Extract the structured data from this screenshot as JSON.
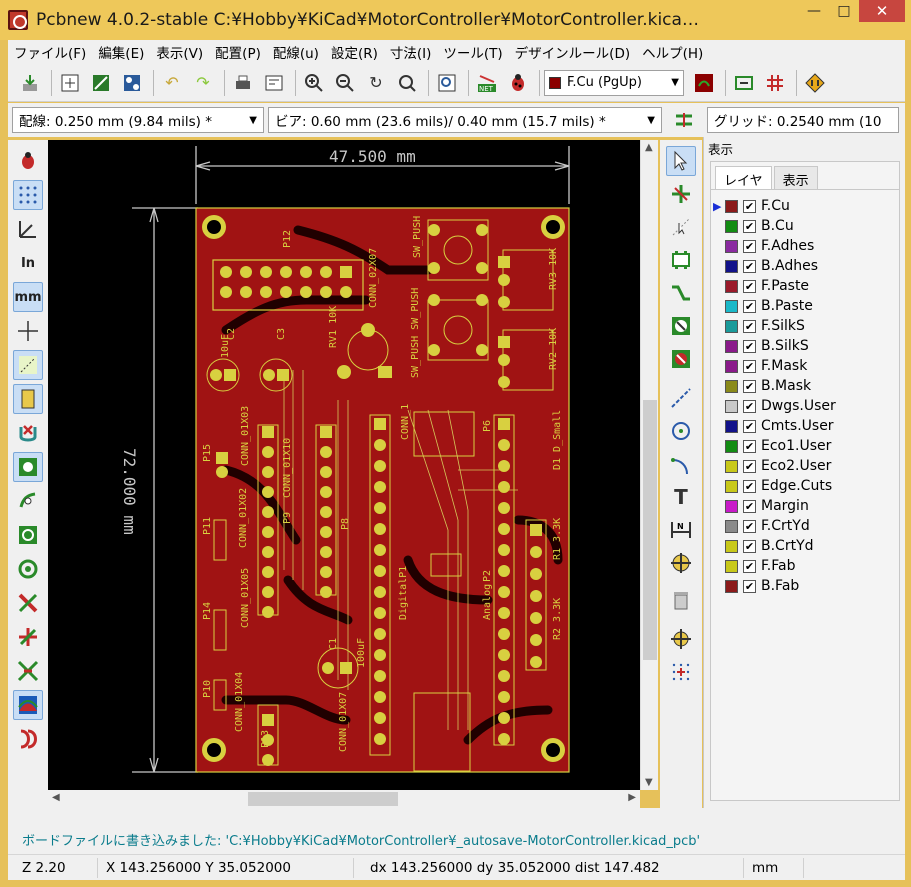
{
  "window": {
    "title": "Pcbnew 4.0.2-stable C:¥Hobby¥KiCad¥MotorController¥MotorController.kica…"
  },
  "menu": [
    "ファイル(F)",
    "編集(E)",
    "表示(V)",
    "配置(P)",
    "配線(u)",
    "設定(R)",
    "寸法(I)",
    "ツール(T)",
    "デザインルール(D)",
    "ヘルプ(H)"
  ],
  "toolbar": {
    "layer_select": "F.Cu (PgUp)",
    "layer_color": "#8b0000"
  },
  "toolbar2": {
    "track_width": "配線: 0.250 mm (9.84 mils) *",
    "via_size": "ビア: 0.60 mm (23.6 mils)/ 0.40 mm (15.7 mils) *",
    "grid": "グリッド: 0.2540 mm (10"
  },
  "canvas": {
    "dim_width": "47.500 mm",
    "dim_height": "72.000 mm",
    "labels": [
      "P12",
      "CONN_02X07",
      "SW_PUSH",
      "SW_PUSH SW_PUSH",
      "RV3 10K",
      "RV2 10K",
      "RV1 10K",
      "10uF",
      "C2",
      "C3",
      "P15",
      "CONN_01X03",
      "CONN_01X02",
      "CONN_01X10",
      "P9",
      "P8",
      "P11",
      "P14",
      "P10",
      "CONN_01X04",
      "CONN_01X05",
      "P13",
      "CONN_01X07",
      "100uF",
      "C1",
      "DigitalP1",
      "Analog",
      "P2",
      "P6",
      "CONN_1",
      "R1 3.3K",
      "R2 3.3K",
      "D1 D_Small",
      "GND"
    ]
  },
  "panel": {
    "title": "表示",
    "tabs": [
      "レイヤ",
      "表示"
    ],
    "layers": [
      {
        "name": "F.Cu",
        "color": "#8b1a1a",
        "checked": true,
        "active": true
      },
      {
        "name": "B.Cu",
        "color": "#138c13",
        "checked": true
      },
      {
        "name": "F.Adhes",
        "color": "#8a2aa0",
        "checked": true
      },
      {
        "name": "B.Adhes",
        "color": "#12128a",
        "checked": true
      },
      {
        "name": "F.Paste",
        "color": "#9a1a2a",
        "checked": true
      },
      {
        "name": "B.Paste",
        "color": "#1ab8c8",
        "checked": true
      },
      {
        "name": "F.SilkS",
        "color": "#1a9a9a",
        "checked": true
      },
      {
        "name": "B.SilkS",
        "color": "#8a1a8a",
        "checked": true
      },
      {
        "name": "F.Mask",
        "color": "#8a1a8a",
        "checked": true
      },
      {
        "name": "B.Mask",
        "color": "#8a8a1a",
        "checked": true
      },
      {
        "name": "Dwgs.User",
        "color": "#c8c8c8",
        "checked": true
      },
      {
        "name": "Cmts.User",
        "color": "#12128a",
        "checked": true
      },
      {
        "name": "Eco1.User",
        "color": "#138c13",
        "checked": true
      },
      {
        "name": "Eco2.User",
        "color": "#c8c81a",
        "checked": true
      },
      {
        "name": "Edge.Cuts",
        "color": "#c8c81a",
        "checked": true
      },
      {
        "name": "Margin",
        "color": "#c81ac8",
        "checked": true
      },
      {
        "name": "F.CrtYd",
        "color": "#8a8a8a",
        "checked": true
      },
      {
        "name": "B.CrtYd",
        "color": "#c8c81a",
        "checked": true
      },
      {
        "name": "F.Fab",
        "color": "#c8c81a",
        "checked": true
      },
      {
        "name": "B.Fab",
        "color": "#8b1a1a",
        "checked": true
      }
    ]
  },
  "status": {
    "message": "ボードファイルに書き込みました: 'C:¥Hobby¥KiCad¥MotorController¥_autosave-MotorController.kicad_pcb'",
    "zoom": "Z 2.20",
    "xy": "X 143.256000  Y 35.052000",
    "dxy": "dx 143.256000  dy 35.052000  dist 147.482",
    "units": "mm"
  }
}
